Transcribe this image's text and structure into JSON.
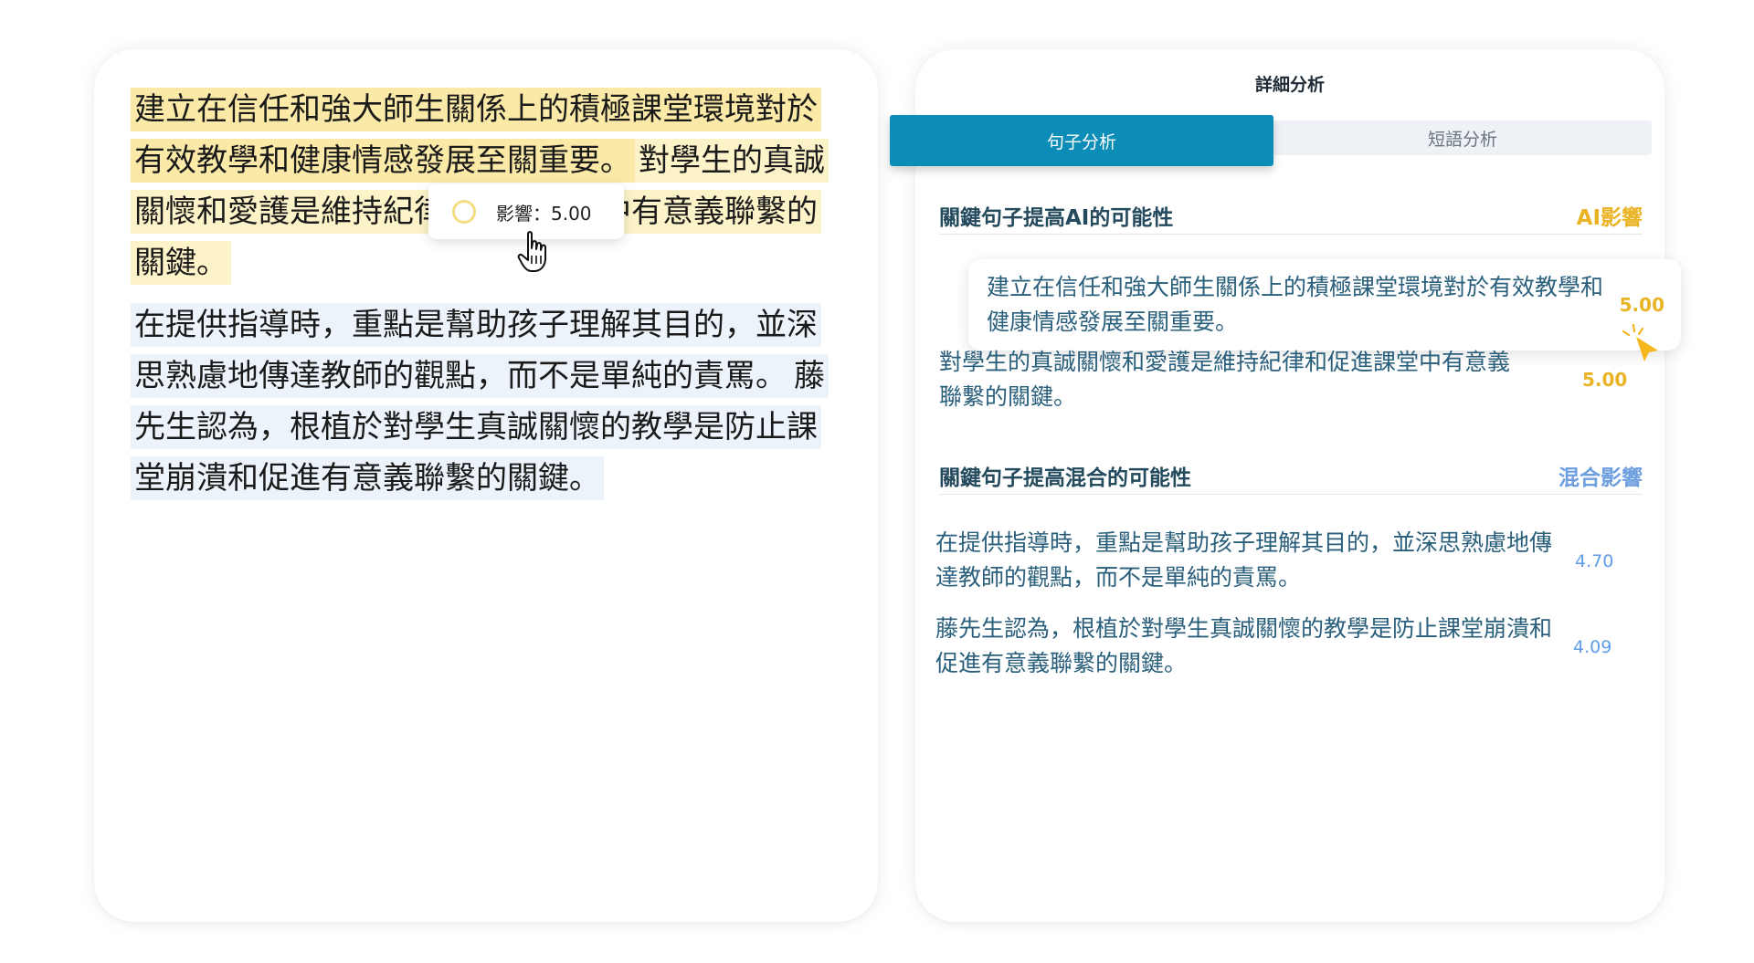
{
  "document": {
    "para1": {
      "seg_ai_strong": "建立在信任和強大師生關係上的積極課堂環境對於有效教學和健康情感發展至關重要。",
      "seg_ai_light": "對學生的真誠關懷和愛護是維持紀律和促進課堂中有意義聯繫的關鍵。"
    },
    "para2": {
      "seg_mix_1": "在提供指導時，重點是幫助孩子理解其目的，並深思熟慮地傳達教師的觀點，而不是單純的責罵。",
      "seg_mix_2": "藤先生認為，根植於對學生真誠關懷的教學是防止課堂崩潰和促進有意義聯繫的關鍵。"
    },
    "tooltip": {
      "label": "影響：5.00"
    }
  },
  "panel": {
    "title": "詳細分析",
    "tabs": {
      "active": "句子分析",
      "inactive": "短語分析"
    },
    "ai_section": {
      "title": "關鍵句子提高AI的可能性",
      "tag": "AI影響",
      "rows": [
        {
          "text": "建立在信任和強大師生關係上的積極課堂環境對於有效教學和健康情感發展至關重要。",
          "score": "5.00"
        },
        {
          "text": "對學生的真誠關懷和愛護是維持紀律和促進課堂中有意義聯繫的關鍵。",
          "score": "5.00"
        }
      ]
    },
    "mix_section": {
      "title": "關鍵句子提高混合的可能性",
      "tag": "混合影響",
      "rows": [
        {
          "text": "在提供指導時，重點是幫助孩子理解其目的，並深思熟慮地傳達教師的觀點，而不是單純的責罵。",
          "score": "4.70"
        },
        {
          "text": "藤先生認為，根植於對學生真誠關懷的教學是防止課堂崩潰和促進有意義聯繫的關鍵。",
          "score": "4.09"
        }
      ]
    }
  },
  "colors": {
    "ai_highlight": "#fbe9a7",
    "ai_highlight_light": "#fdf3c9",
    "mix_highlight": "#edf3fb",
    "active_tab": "#0b8db8",
    "ai_accent": "#e9b324",
    "mix_accent": "#6d9ee0",
    "sentence_text": "#2a5f7c"
  },
  "icons": {
    "tooltip": "circle-ring-icon",
    "hover_cursor": "hand-pointer-icon",
    "click_cursor": "arrow-click-icon"
  }
}
